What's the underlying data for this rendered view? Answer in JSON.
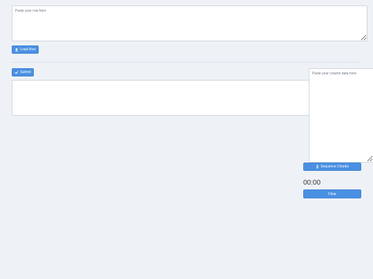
{
  "row_input": {
    "placeholder": "Paste your row here"
  },
  "load_row_button": {
    "label": "Load Row",
    "icon": "upload-icon"
  },
  "submit_button": {
    "label": "Submit",
    "icon": "check-icon"
  },
  "column_input": {
    "placeholder": "Paste your column data here"
  },
  "sequence_button": {
    "label": "Sequence Chunks",
    "icon": "sort-icon"
  },
  "timer": {
    "value": "00:00"
  },
  "clear_button": {
    "label": "Clear"
  },
  "colors": {
    "accent": "#4a90e2",
    "background": "#eef2f6"
  }
}
